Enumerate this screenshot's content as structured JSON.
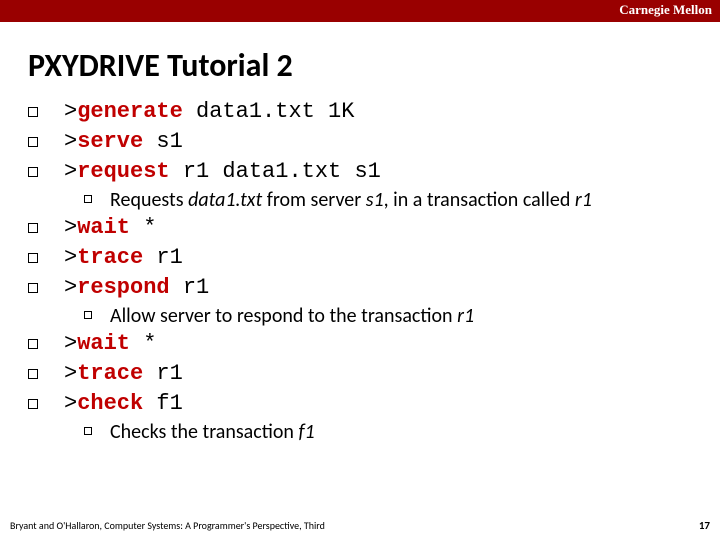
{
  "brand": "Carnegie Mellon",
  "title_prefix": "PXYDRIVE",
  "title_rest": " Tutorial 2",
  "items": [
    {
      "level": 1,
      "plain": ">",
      "kw": "generate",
      "args": " data1.txt 1K"
    },
    {
      "level": 1,
      "plain": ">",
      "kw": "serve",
      "args": " s1"
    },
    {
      "level": 1,
      "plain": ">",
      "kw": "request",
      "args": " r1 data1.txt s1"
    },
    {
      "level": 2,
      "note_pre": "Requests ",
      "note_em1": "data1.txt",
      "note_mid": " from server ",
      "note_em2": "s1",
      "note_mid2": ", in a transaction called ",
      "note_em3": "r1"
    },
    {
      "level": 1,
      "plain": ">",
      "kw": "wait",
      "args": " *"
    },
    {
      "level": 1,
      "plain": ">",
      "kw": "trace",
      "args": " r1"
    },
    {
      "level": 1,
      "plain": ">",
      "kw": "respond",
      "args": " r1"
    },
    {
      "level": 2,
      "note_pre": "Allow server to respond to the transaction ",
      "note_em1": "r1"
    },
    {
      "level": 1,
      "plain": ">",
      "kw": "wait",
      "args": " *"
    },
    {
      "level": 1,
      "plain": ">",
      "kw": "trace",
      "args": " r1"
    },
    {
      "level": 1,
      "plain": ">",
      "kw": "check",
      "args": " f1"
    },
    {
      "level": 2,
      "note_pre": "Checks the transaction ",
      "note_em1": "f1"
    }
  ],
  "footer": "Bryant and O'Hallaron, Computer Systems: A Programmer's Perspective, Third",
  "page": "17"
}
